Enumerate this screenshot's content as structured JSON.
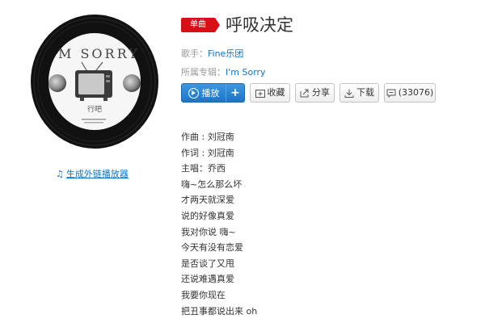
{
  "album_art": {
    "cover_text": "M SORRY",
    "cover_subtext": "行吧"
  },
  "player_link": {
    "icon": "music-note-icon",
    "label": "生成外链播放器"
  },
  "song": {
    "badge": "单曲",
    "title": "呼吸决定"
  },
  "singer": {
    "label": "歌手：",
    "value": "Fine乐团"
  },
  "album": {
    "label": "所属专辑：",
    "value": "I'm Sorry"
  },
  "actions": {
    "play": "播放",
    "add": "+",
    "collect": "收藏",
    "share": "分享",
    "download": "下载",
    "comments": "(33076)"
  },
  "colors": {
    "accent_blue": "#2a80cf",
    "badge_red": "#d80f16",
    "link_blue": "#0c73c2"
  },
  "lyrics": [
    "作曲 : 刘冠南",
    "作词 : 刘冠南",
    "主唱：乔西",
    "嗨~怎么那么坏",
    "才两天就深爱",
    "说的好像真爱",
    "我对你说 嗨~",
    "今天有没有恋爱",
    "是否谈了又甩",
    "还说难遇真爱",
    "我要你现在",
    "把丑事都说出来 oh"
  ]
}
